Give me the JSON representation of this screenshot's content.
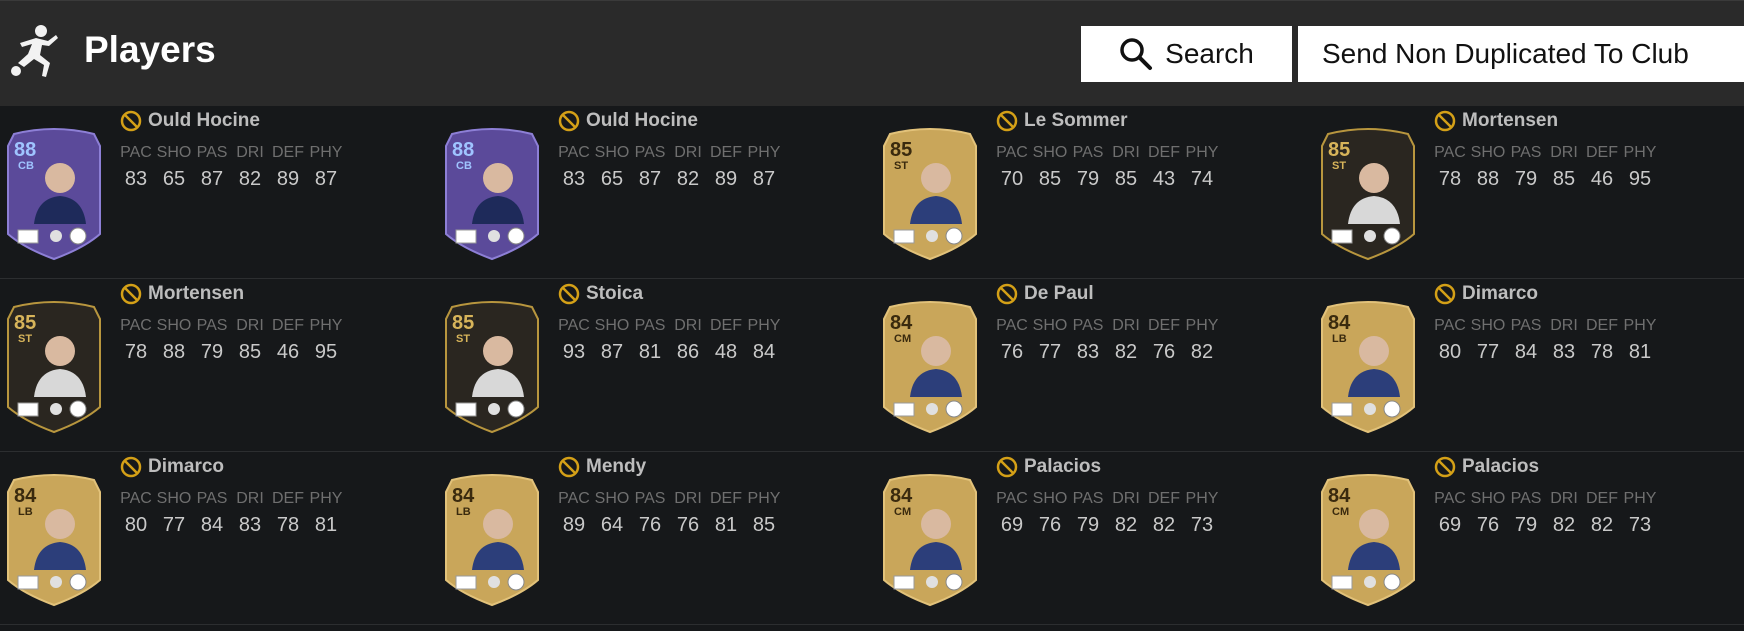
{
  "header": {
    "title": "Players",
    "search_label": "Search",
    "send_label": "Send Non Duplicated To Club"
  },
  "stat_labels": [
    "PAC",
    "SHO",
    "PAS",
    "DRI",
    "DEF",
    "PHY"
  ],
  "rows": [
    [
      {
        "name": "Ould Hocine",
        "rating": "88",
        "position": "CB",
        "card_style": "purple",
        "stats": [
          "83",
          "65",
          "87",
          "82",
          "89",
          "87"
        ]
      },
      {
        "name": "Ould Hocine",
        "rating": "88",
        "position": "CB",
        "card_style": "purple",
        "stats": [
          "83",
          "65",
          "87",
          "82",
          "89",
          "87"
        ]
      },
      {
        "name": "Le Sommer",
        "rating": "85",
        "position": "ST",
        "card_style": "gold",
        "stats": [
          "70",
          "85",
          "79",
          "85",
          "43",
          "74"
        ]
      },
      {
        "name": "Mortensen",
        "rating": "85",
        "position": "ST",
        "card_style": "dark",
        "stats": [
          "78",
          "88",
          "79",
          "85",
          "46",
          "95"
        ]
      }
    ],
    [
      {
        "name": "Mortensen",
        "rating": "85",
        "position": "ST",
        "card_style": "dark",
        "stats": [
          "78",
          "88",
          "79",
          "85",
          "46",
          "95"
        ]
      },
      {
        "name": "Stoica",
        "rating": "85",
        "position": "ST",
        "card_style": "dark",
        "stats": [
          "93",
          "87",
          "81",
          "86",
          "48",
          "84"
        ]
      },
      {
        "name": "De Paul",
        "rating": "84",
        "position": "CM",
        "card_style": "gold",
        "stats": [
          "76",
          "77",
          "83",
          "82",
          "76",
          "82"
        ]
      },
      {
        "name": "Dimarco",
        "rating": "84",
        "position": "LB",
        "card_style": "gold",
        "stats": [
          "80",
          "77",
          "84",
          "83",
          "78",
          "81"
        ]
      }
    ],
    [
      {
        "name": "Dimarco",
        "rating": "84",
        "position": "LB",
        "card_style": "gold",
        "stats": [
          "80",
          "77",
          "84",
          "83",
          "78",
          "81"
        ]
      },
      {
        "name": "Mendy",
        "rating": "84",
        "position": "LB",
        "card_style": "gold",
        "stats": [
          "89",
          "64",
          "76",
          "76",
          "81",
          "85"
        ]
      },
      {
        "name": "Palacios",
        "rating": "84",
        "position": "CM",
        "card_style": "gold",
        "stats": [
          "69",
          "76",
          "79",
          "82",
          "82",
          "73"
        ]
      },
      {
        "name": "Palacios",
        "rating": "84",
        "position": "CM",
        "card_style": "gold",
        "stats": [
          "69",
          "76",
          "79",
          "82",
          "82",
          "73"
        ]
      }
    ]
  ],
  "colors": {
    "gold_card": "#c9a65a",
    "purple_card": "#5b4a9a",
    "dark_card": "#2a2620",
    "coin": "#d4a017"
  }
}
